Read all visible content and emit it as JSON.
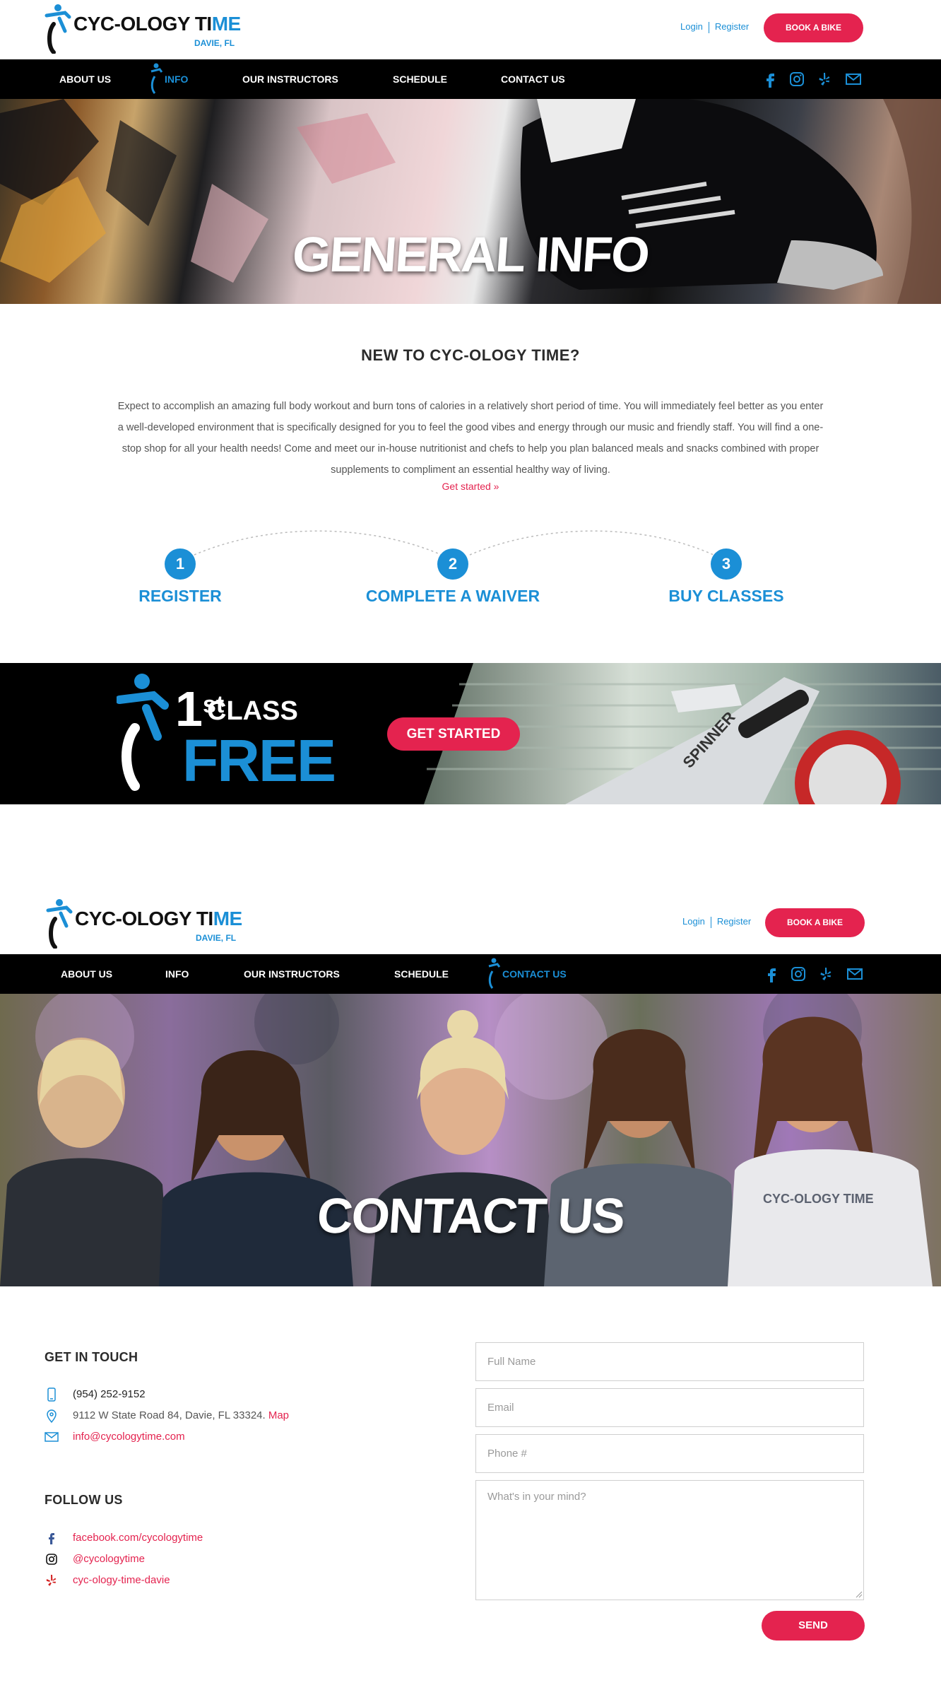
{
  "header1": {
    "brand": "CYC-OLOGY TI",
    "brand_accent": "ME",
    "location": "DAVIE, FL",
    "login": "Login",
    "register": "Register",
    "book_button": "BOOK A BIKE"
  },
  "nav1": {
    "items": [
      "ABOUT US",
      "INFO",
      "OUR INSTRUCTORS",
      "SCHEDULE",
      "CONTACT US"
    ],
    "active": "INFO"
  },
  "hero1": {
    "title": "GENERAL INFO"
  },
  "info": {
    "heading": "NEW TO CYC-OLOGY TIME?",
    "body": "Expect to accomplish an amazing full body workout and burn tons of calories in a relatively short period of time. You will immediately feel better as you enter a well-developed environment that is specifically designed for you to feel the good vibes and energy through our music and friendly staff. You will find a one-stop shop for all your health needs! Come and meet our in-house nutritionist and chefs to help you plan balanced meals and snacks combined with proper supplements to compliment an essential healthy way of living.",
    "link": "Get started »",
    "steps": [
      {
        "number": "1",
        "label": "REGISTER"
      },
      {
        "number": "2",
        "label": "COMPLETE A WAIVER"
      },
      {
        "number": "3",
        "label": "BUY CLASSES"
      }
    ]
  },
  "promo": {
    "line1_num": "1",
    "line1_sup": "st",
    "line2": "CLASS",
    "line3": "FREE",
    "cta": "GET STARTED",
    "bike_brand": "SPINNER"
  },
  "header2": {
    "brand": "CYC-OLOGY TI",
    "brand_accent": "ME",
    "location": "DAVIE, FL",
    "login": "Login",
    "register": "Register",
    "book_button": "BOOK A BIKE"
  },
  "nav2": {
    "items": [
      "ABOUT US",
      "INFO",
      "OUR INSTRUCTORS",
      "SCHEDULE",
      "CONTACT US"
    ],
    "active": "CONTACT US"
  },
  "hero2": {
    "title": "CONTACT US",
    "shirt_text": "CYC-OLOGY TIME"
  },
  "contact": {
    "get_in_touch": "GET IN TOUCH",
    "phone": "(954) 252-9152",
    "address": "9112 W State Road 84, Davie, FL 33324.",
    "map_link": "Map",
    "email": "info@cycologytime.com",
    "follow_us": "FOLLOW US",
    "facebook": "facebook.com/cycologytime",
    "instagram": "@cycologytime",
    "yelp": "cyc-ology-time-davie"
  },
  "form": {
    "name_placeholder": "Full Name",
    "email_placeholder": "Email",
    "phone_placeholder": "Phone #",
    "message_placeholder": "What's in your mind?",
    "send": "SEND"
  },
  "colors": {
    "brand_blue": "#1b8fd6",
    "brand_red": "#e4234f",
    "nav_black": "#000000"
  }
}
